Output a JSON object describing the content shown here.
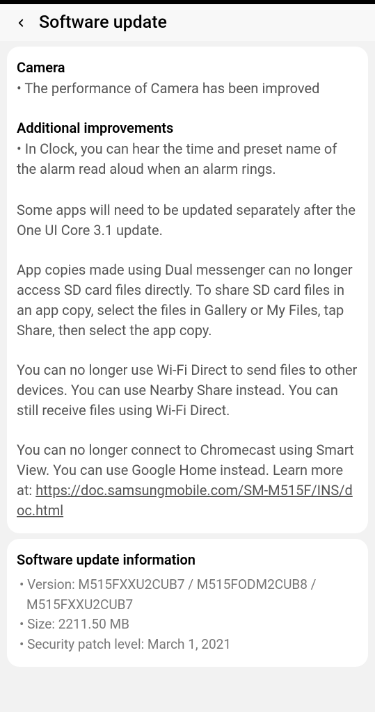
{
  "header": {
    "title": "Software update"
  },
  "main": {
    "camera_heading": "Camera",
    "camera_bullet": "• The performance of Camera has been improved",
    "additional_heading": "Additional improvements",
    "additional_bullet": "• In Clock, you can hear the time and preset name of the alarm read aloud when an alarm rings.",
    "para_apps": "Some apps will need to be updated separately after the One UI Core 3.1 update.",
    "para_dual": "App copies made using Dual messenger can no longer access SD card files directly. To share SD card files in an app copy, select the files in Gallery or My Files, tap Share, then select the app copy.",
    "para_wifi": "You can no longer use Wi-Fi Direct to send files to other devices. You can use Nearby Share instead. You can still receive files using Wi-Fi Direct.",
    "para_chromecast_prefix": "You can no longer connect to Chromecast using Smart View. You can use Google Home instead. Learn more at: ",
    "learn_more_link": "https://doc.samsungmobile.com/SM-M515F/INS/doc.html"
  },
  "info": {
    "heading": "Software update information",
    "version": "• Version: M515FXXU2CUB7 / M515FODM2CUB8 / M515FXXU2CUB7",
    "size": "• Size: 2211.50 MB",
    "patch": "• Security patch level: March 1, 2021"
  }
}
